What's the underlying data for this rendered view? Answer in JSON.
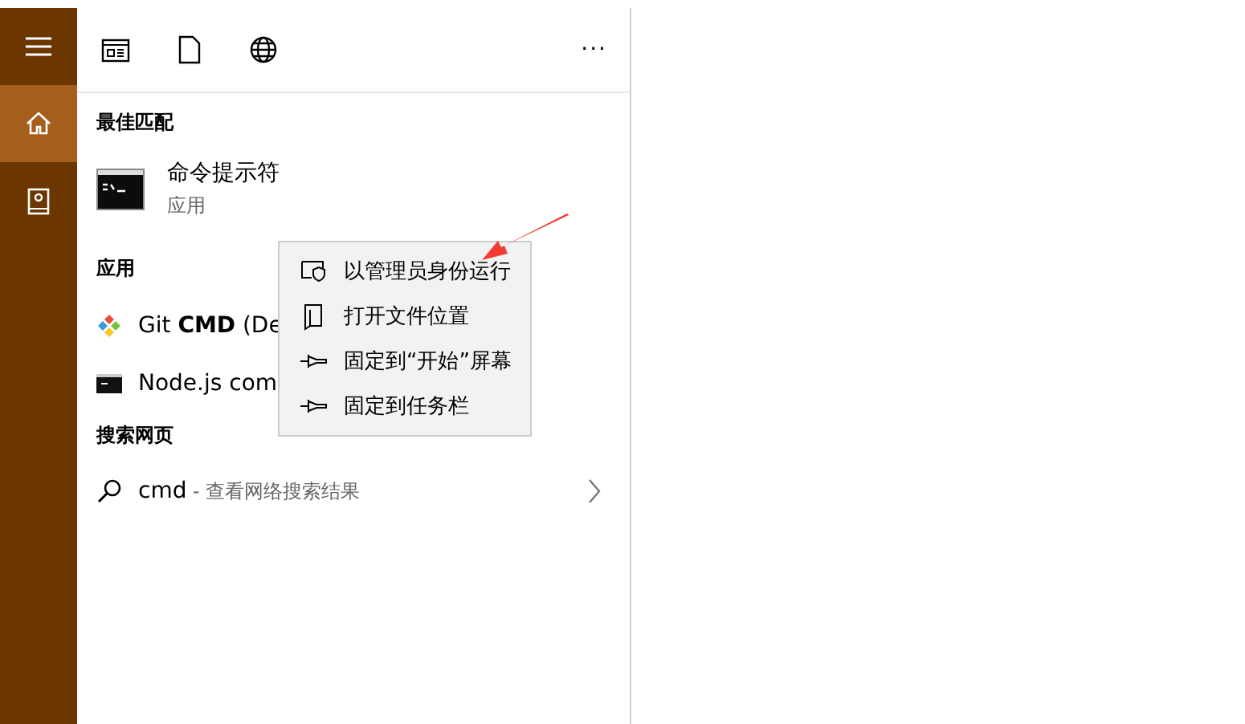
{
  "sidebar": {
    "items": [
      {
        "kind": "menu",
        "selected": false
      },
      {
        "kind": "home",
        "selected": true
      },
      {
        "kind": "notebook",
        "selected": false
      }
    ]
  },
  "toolbar": {
    "items": [
      {
        "kind": "apps"
      },
      {
        "kind": "documents"
      },
      {
        "kind": "web"
      }
    ],
    "more": "···"
  },
  "best_match": {
    "heading": "最佳匹配",
    "title": "命令提示符",
    "subtitle": "应用"
  },
  "apps": {
    "heading": "应用",
    "items": [
      {
        "kind": "git",
        "label": "Git **CMD** (De"
      },
      {
        "kind": "console",
        "label": "Node.js com"
      }
    ]
  },
  "web": {
    "heading": "搜索网页",
    "query": "cmd",
    "hint": " - 查看网络搜索结果"
  },
  "context_menu": {
    "items": [
      {
        "kind": "shield",
        "label": "以管理员身份运行"
      },
      {
        "kind": "folder",
        "label": "打开文件位置"
      },
      {
        "kind": "pin",
        "label": "固定到“开始”屏幕"
      },
      {
        "kind": "pin",
        "label": "固定到任务栏"
      }
    ]
  }
}
